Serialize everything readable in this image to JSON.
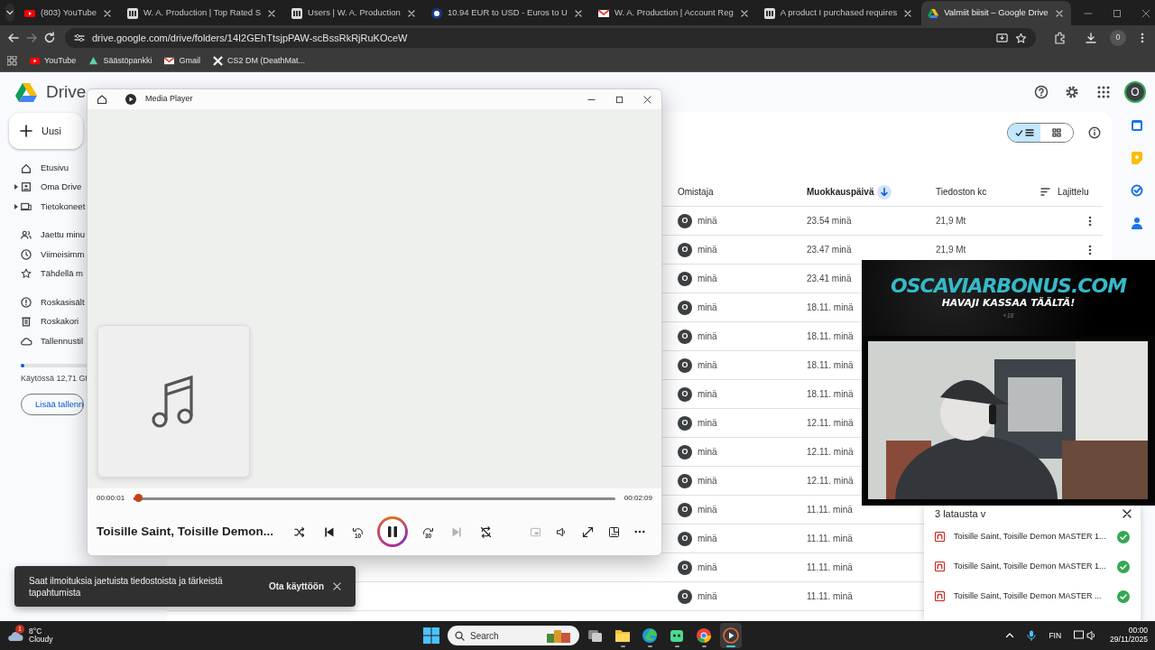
{
  "browser": {
    "tabs": [
      {
        "title": "(803) YouTube",
        "kind": "video",
        "selected": false
      },
      {
        "title": "W. A. Production | Top Rated S",
        "kind": "page",
        "selected": false
      },
      {
        "title": "Users | W. A. Production",
        "kind": "page",
        "selected": false
      },
      {
        "title": "10.94 EUR to USD - Euros to U",
        "kind": "currency",
        "selected": false
      },
      {
        "title": "W. A. Production | Account Reg",
        "kind": "mail",
        "selected": false
      },
      {
        "title": "A product I purchased requires",
        "kind": "page",
        "selected": false
      },
      {
        "title": "Valmiit biisit – Google Drive",
        "kind": "drive",
        "selected": true
      }
    ],
    "address": "drive.google.com/drive/folders/14I2GEhTtsjpPAW-scBssRkRjRuKOceW",
    "profile": "0",
    "bookmarks": [
      {
        "label": "YouTube",
        "kind": "video"
      },
      {
        "label": "Säästöpankki",
        "kind": "bank"
      },
      {
        "label": "Gmail",
        "kind": "mail"
      },
      {
        "label": "CS2 DM (DeathMat...",
        "kind": "game"
      }
    ]
  },
  "drive": {
    "logo": "Drive",
    "avatar": "O",
    "new_button": "Uusi",
    "sidebar": {
      "items": [
        {
          "label": "Etusivu",
          "expandable": false
        },
        {
          "label": "Oma Drive",
          "expandable": true
        },
        {
          "label": "Tietokoneet",
          "expandable": true
        },
        {
          "label": "Jaettu minu",
          "expandable": false
        },
        {
          "label": "Viimeisimm",
          "expandable": false
        },
        {
          "label": "Tähdellä m",
          "expandable": false
        },
        {
          "label": "Roskasisält",
          "expandable": false
        },
        {
          "label": "Roskakori",
          "expandable": false
        },
        {
          "label": "Tallennustil",
          "expandable": false
        }
      ],
      "storage": {
        "level": 0.04,
        "text": "Käytössä 12,71 Gt",
        "button": "Lisää tallenn"
      }
    },
    "view_toggle": [
      {
        "kind": "list",
        "selected": true
      },
      {
        "kind": "grid",
        "selected": false
      }
    ],
    "table": {
      "columns": [
        {
          "label": "Omistaja",
          "sorted": false
        },
        {
          "label": "Muokkauspäivä",
          "sorted": true
        },
        {
          "label": "Tiedoston kc",
          "sorted": false
        }
      ],
      "sort_button": "Lajittelu",
      "rows": [
        {
          "avatar": "O",
          "owner": "minä",
          "modified": "23.54 minä",
          "size": "21,9 Mt",
          "menu": true
        },
        {
          "avatar": "O",
          "owner": "minä",
          "modified": "23.47 minä",
          "size": "21,9 Mt",
          "menu": true
        },
        {
          "avatar": "O",
          "owner": "minä",
          "modified": "23.41 minä"
        },
        {
          "avatar": "O",
          "owner": "minä",
          "modified": "18.11. minä"
        },
        {
          "avatar": "O",
          "owner": "minä",
          "modified": "18.11. minä"
        },
        {
          "avatar": "O",
          "owner": "minä",
          "modified": "18.11. minä"
        },
        {
          "avatar": "O",
          "owner": "minä",
          "modified": "18.11. minä"
        },
        {
          "avatar": "O",
          "owner": "minä",
          "modified": "12.11. minä"
        },
        {
          "avatar": "O",
          "owner": "minä",
          "modified": "12.11. minä"
        },
        {
          "avatar": "O",
          "owner": "minä",
          "modified": "12.11. minä"
        },
        {
          "avatar": "O",
          "owner": "minä",
          "modified": "11.11. minä"
        },
        {
          "avatar": "O",
          "owner": "minä",
          "modified": "11.11. minä"
        },
        {
          "avatar": "O",
          "owner": "minä",
          "modified": "11.11. minä"
        },
        {
          "avatar": "O",
          "owner": "minä",
          "modified": "11.11. minä"
        }
      ]
    }
  },
  "media_player": {
    "title": "Media Player",
    "elapsed": "00:00:01",
    "duration": "00:02:09",
    "level": 0.01,
    "track": "Toisille Saint, Toisille Demon...",
    "controls": [
      {
        "kind": "shuffle",
        "disabled": false
      },
      {
        "kind": "previous",
        "disabled": false
      },
      {
        "kind": "rewind",
        "label": "10",
        "disabled": false
      },
      {
        "kind": "play_pause",
        "playing": true
      },
      {
        "kind": "forward",
        "label": "30",
        "disabled": false
      },
      {
        "kind": "next",
        "disabled": true
      },
      {
        "kind": "repeat",
        "disabled": false
      }
    ],
    "tools": [
      {
        "kind": "miniplayer",
        "disabled": true
      },
      {
        "kind": "volume",
        "disabled": false
      },
      {
        "kind": "fullscreen",
        "disabled": false
      },
      {
        "kind": "cast",
        "disabled": false
      },
      {
        "kind": "more",
        "disabled": false
      }
    ]
  },
  "stream_overlay": {
    "site": "OSCAVIARBONUS.COM",
    "tagline": "HAVAJI KASSAA TÄÄLTÄ!",
    "age": "+18"
  },
  "downloads": {
    "header": "3 latausta v",
    "items": [
      {
        "name": "Toisille Saint, Toisille Demon MASTER 1...",
        "done": true
      },
      {
        "name": "Toisille Saint, Toisille Demon MASTER 1...",
        "done": true
      },
      {
        "name": "Toisille Saint, Toisille Demon MASTER ...",
        "done": true
      }
    ]
  },
  "toast": {
    "message": "Saat ilmoituksia jaetuista tiedostoista ja tärkeistä tapahtumista",
    "action": "Ota käyttöön"
  },
  "taskbar": {
    "weather": {
      "badge": "1",
      "temp": "8°C",
      "condition": "Cloudy"
    },
    "search": "Search",
    "apps": [
      {
        "kind": "task_view",
        "selected": false
      },
      {
        "kind": "explorer",
        "selected": false
      },
      {
        "kind": "edge",
        "selected": false
      },
      {
        "kind": "chat",
        "selected": false
      },
      {
        "kind": "chrome",
        "selected": false
      },
      {
        "kind": "media",
        "selected": true
      }
    ],
    "language": "FIN",
    "time": "00:00",
    "date": "29/11/2025"
  }
}
